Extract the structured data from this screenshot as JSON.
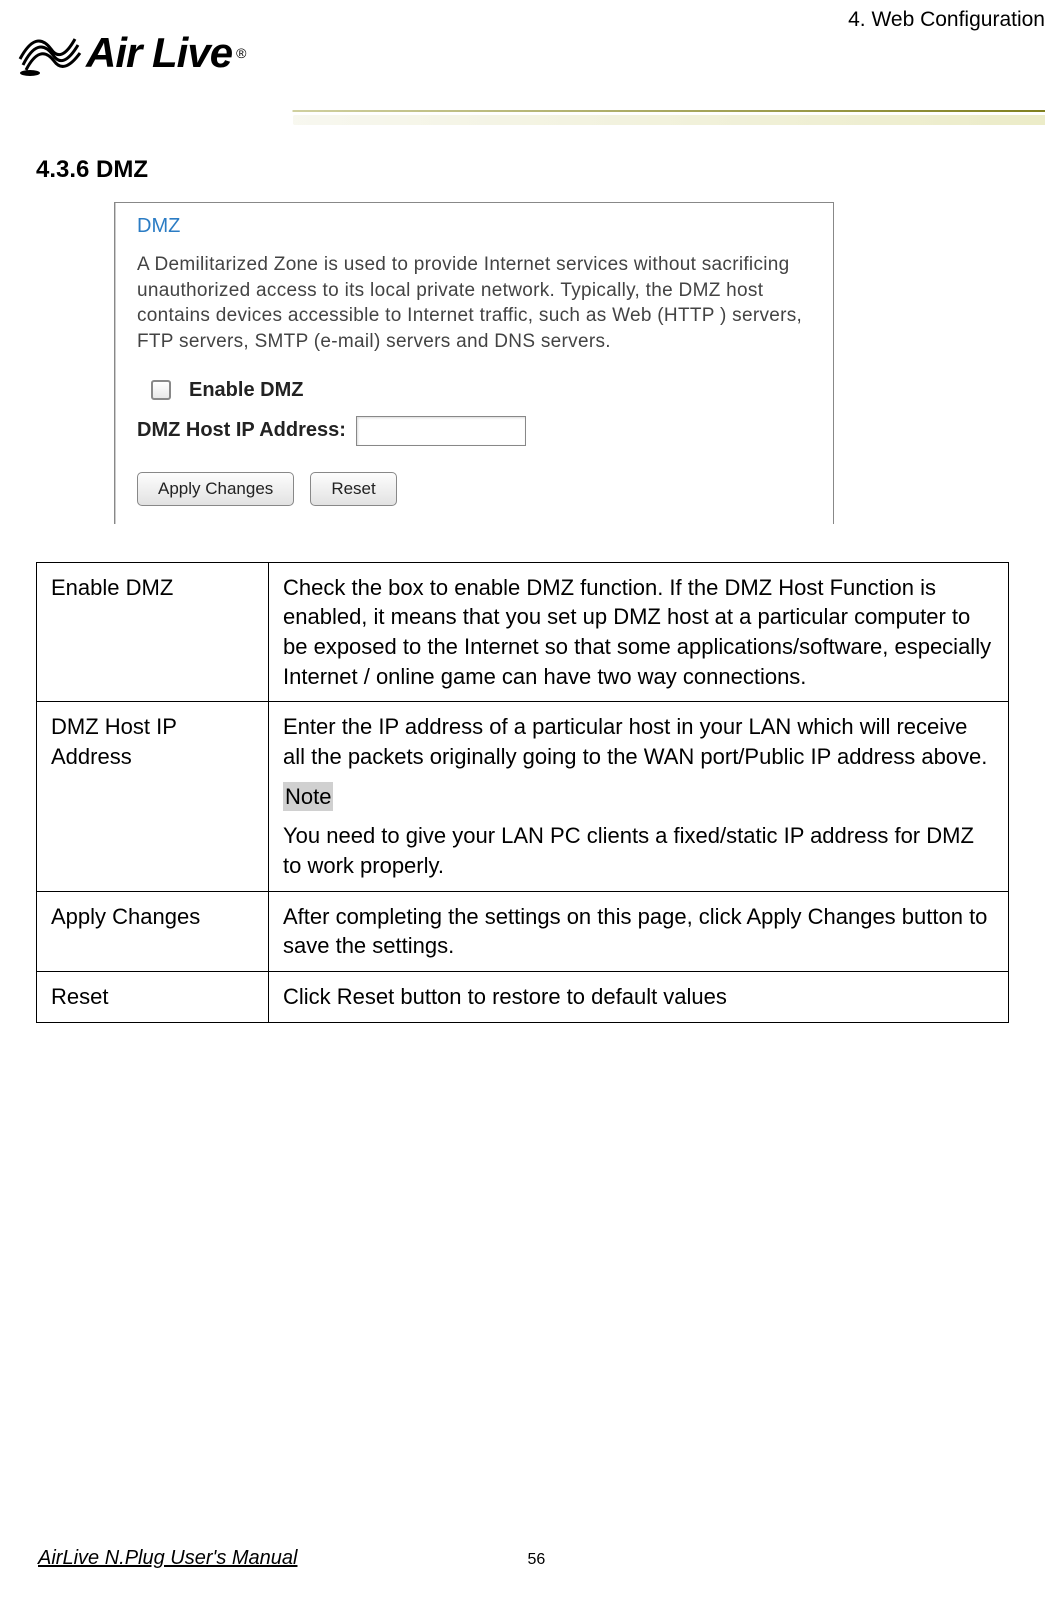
{
  "header": {
    "breadcrumb": "4. Web Configuration",
    "logo_text": "Air Live",
    "logo_r": "®"
  },
  "section": {
    "heading": "4.3.6 DMZ"
  },
  "screenshot": {
    "title": "DMZ",
    "description": "A Demilitarized Zone is used to provide Internet services without sacrificing unauthorized access to its local private network. Typically, the DMZ host contains devices accessible to Internet traffic, such as Web (HTTP ) servers, FTP servers, SMTP (e-mail) servers and DNS servers.",
    "checkbox_label": "Enable DMZ",
    "input_label": "DMZ Host IP Address:",
    "input_value": "",
    "apply_button": "Apply Changes",
    "reset_button": "Reset"
  },
  "table": {
    "rows": [
      {
        "label": "Enable DMZ",
        "desc": "Check the box to enable DMZ function. If the DMZ Host Function is enabled, it means that you set up DMZ host at a particular computer to be exposed to the Internet so that some applications/software, especially Internet / online game can have two way connections."
      },
      {
        "label": "DMZ Host IP Address",
        "desc_part1": "Enter the IP address of a particular host in your LAN which will receive all the packets originally going to the WAN port/Public IP address above.",
        "note_label": "Note",
        "desc_part2": "You need to give your LAN PC clients a fixed/static IP address for DMZ to work properly."
      },
      {
        "label": "Apply Changes",
        "desc": "After completing the settings on this page, click Apply Changes button to save the settings."
      },
      {
        "label": "Reset",
        "desc": "Click Reset button to restore to default values"
      }
    ]
  },
  "footer": {
    "manual": "AirLive N.Plug User's Manual",
    "page": "56"
  }
}
